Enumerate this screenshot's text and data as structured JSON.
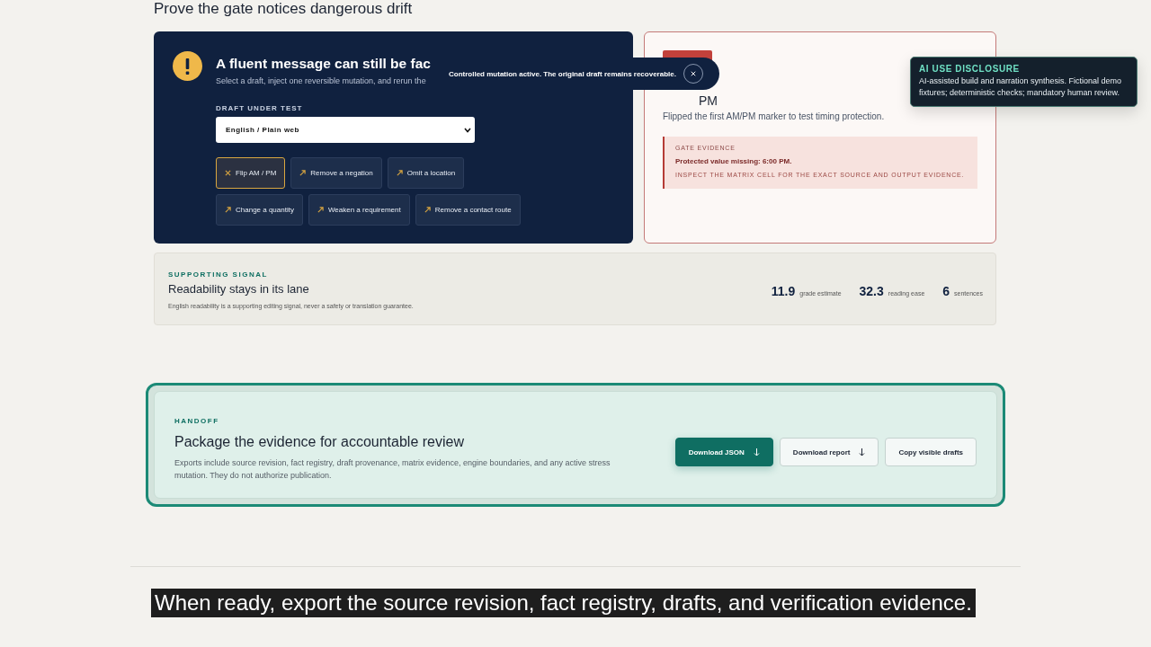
{
  "page_heading": "Prove the gate notices dangerous drift",
  "mutation_card": {
    "title": "A fluent message can still be fac",
    "subtitle": "Select a draft, inject one reversible mutation, and rerun the",
    "field_label": "DRAFT UNDER TEST",
    "draft_select": {
      "value": "English / Plain web"
    },
    "mutations": [
      {
        "label": "Flip AM / PM",
        "selected": true
      },
      {
        "label": "Remove a negation",
        "selected": false
      },
      {
        "label": "Omit a location",
        "selected": false
      },
      {
        "label": "Change a quantity",
        "selected": false
      },
      {
        "label": "Weaken a requirement",
        "selected": false
      },
      {
        "label": "Remove a contact route",
        "selected": false
      }
    ]
  },
  "toast": {
    "message": "Controlled mutation active. The original draft remains recoverable."
  },
  "result_card": {
    "title": "PM",
    "description": "Flipped the first AM/PM marker to test timing protection.",
    "evidence": {
      "label": "GATE EVIDENCE",
      "finding": "Protected value missing: 6:00 PM.",
      "hint": "INSPECT THE MATRIX CELL FOR THE EXACT SOURCE AND OUTPUT EVIDENCE."
    }
  },
  "ai_disclosure": {
    "title": "AI USE DISCLOSURE",
    "text": "AI-assisted build and narration synthesis. Fictional demo fixtures; deterministic checks; mandatory human review."
  },
  "readability": {
    "eyebrow": "SUPPORTING SIGNAL",
    "title": "Readability stays in its lane",
    "note": "English readability is a supporting editing signal, never a safety or translation guarantee.",
    "metrics": [
      {
        "value": "11.9",
        "label": "grade estimate"
      },
      {
        "value": "32.3",
        "label": "reading ease"
      },
      {
        "value": "6",
        "label": "sentences"
      }
    ]
  },
  "handoff": {
    "eyebrow": "HANDOFF",
    "title": "Package the evidence for accountable review",
    "text": "Exports include source revision, fact registry, draft provenance, matrix evidence, engine boundaries, and any active stress mutation. They do not authorize publication.",
    "buttons": [
      {
        "label": "Download JSON",
        "kind": "primary",
        "download": true
      },
      {
        "label": "Download report",
        "kind": "secondary",
        "download": true
      },
      {
        "label": "Copy visible drafts",
        "kind": "secondary",
        "download": false
      }
    ]
  },
  "caption": "When ready, export the source revision, fact registry, drafts, and verification evidence."
}
